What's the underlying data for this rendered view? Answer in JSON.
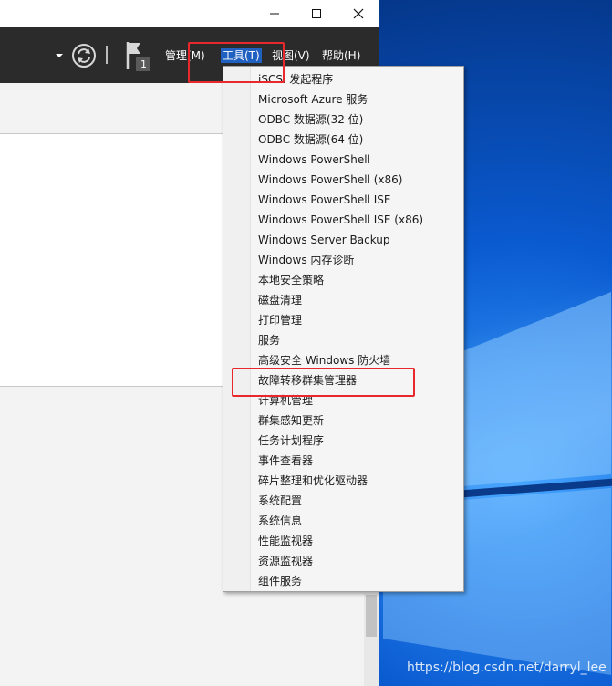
{
  "toolbar": {
    "flag_count": "1",
    "menus": {
      "manage": "管理(M)",
      "tools": "工具(T)",
      "view": "视图(V)",
      "help": "帮助(H)"
    }
  },
  "tools_menu": {
    "items": [
      "iSCSI 发起程序",
      "Microsoft Azure 服务",
      "ODBC 数据源(32 位)",
      "ODBC 数据源(64 位)",
      "Windows PowerShell",
      "Windows PowerShell (x86)",
      "Windows PowerShell ISE",
      "Windows PowerShell ISE (x86)",
      "Windows Server Backup",
      "Windows 内存诊断",
      "本地安全策略",
      "磁盘清理",
      "打印管理",
      "服务",
      "高级安全 Windows 防火墙",
      "故障转移群集管理器",
      "计算机管理",
      "群集感知更新",
      "任务计划程序",
      "事件查看器",
      "碎片整理和优化驱动器",
      "系统配置",
      "系统信息",
      "性能监视器",
      "资源监视器",
      "组件服务"
    ]
  },
  "watermark": "https://blog.csdn.net/darryl_lee",
  "colors": {
    "toolbar_bg": "#2b2b2b",
    "highlight_box": "#e8282b",
    "active_menu": "#2060c0"
  }
}
